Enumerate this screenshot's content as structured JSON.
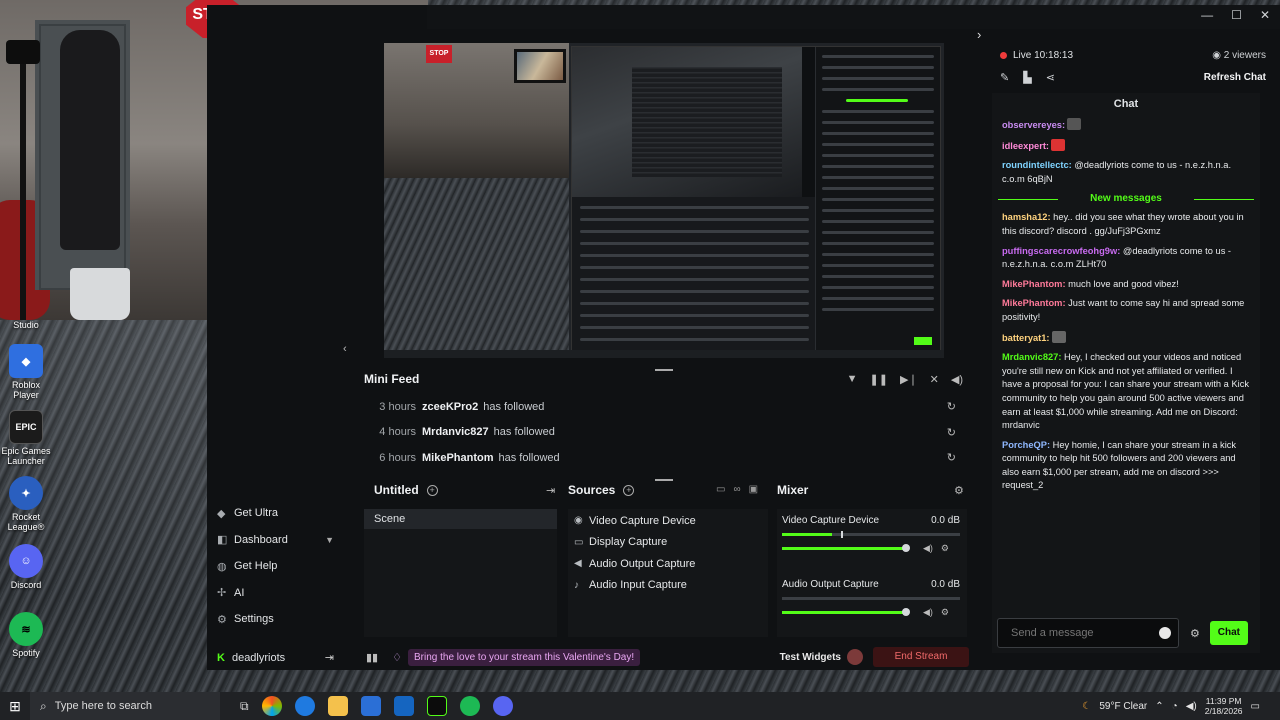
{
  "desktop": {
    "icons": [
      {
        "label": "Studio",
        "icon": "studio-icon",
        "color": "#1a1a1a"
      },
      {
        "label": "Roblox Player",
        "icon": "roblox-icon",
        "color": "#2f6fe0"
      },
      {
        "label": "Epic Games Launcher",
        "icon": "epic-games-icon",
        "color": "#1b1b1b"
      },
      {
        "label": "Rocket League®",
        "icon": "rocket-league-icon",
        "color": "#2a5fbf"
      },
      {
        "label": "Discord",
        "icon": "discord-icon",
        "color": "#5865f2"
      },
      {
        "label": "Spotify",
        "icon": "spotify-icon",
        "color": "#1db954"
      }
    ],
    "webcam_sign": "STOP",
    "epic_glyph": "EPIC"
  },
  "window": {
    "controls": [
      "—",
      "☐",
      "✕"
    ]
  },
  "nav": {
    "items": [
      {
        "label": "Get Ultra",
        "icon": "ultra-icon"
      },
      {
        "label": "Dashboard",
        "icon": "dashboard-icon"
      },
      {
        "label": "Get Help",
        "icon": "help-icon"
      },
      {
        "label": "AI",
        "icon": "ai-icon"
      },
      {
        "label": "Settings",
        "icon": "gear-icon"
      }
    ],
    "user": "deadlyriots"
  },
  "minifeed": {
    "title": "Mini Feed",
    "rows": [
      {
        "time": "3 hours",
        "user": "zceeKPro2",
        "action": "has followed"
      },
      {
        "time": "4 hours",
        "user": "Mrdanvic827",
        "action": "has followed"
      },
      {
        "time": "6 hours",
        "user": "MikePhantom",
        "action": "has followed"
      }
    ]
  },
  "scenes": {
    "title": "Untitled",
    "items": [
      "Scene"
    ]
  },
  "sources": {
    "title": "Sources",
    "items": [
      {
        "label": "Video Capture Device",
        "icon": "camera-icon"
      },
      {
        "label": "Display Capture",
        "icon": "monitor-icon"
      },
      {
        "label": "Audio Output Capture",
        "icon": "speaker-icon"
      },
      {
        "label": "Audio Input Capture",
        "icon": "microphone-icon"
      }
    ]
  },
  "mixer": {
    "title": "Mixer",
    "channels": [
      {
        "name": "Video Capture Device",
        "db": "0.0 dB",
        "level": 0.28,
        "peak": 0.33,
        "volume": 1.0
      },
      {
        "name": "Audio Output Capture",
        "db": "0.0 dB",
        "level": 0.0,
        "peak": 0.0,
        "volume": 1.0
      }
    ]
  },
  "bottombar": {
    "promo": "Bring the love to your stream this Valentine's Day!",
    "test_widgets": "Test Widgets",
    "end_stream": "End Stream"
  },
  "stream": {
    "live": "Live 10:18:13",
    "viewers": "2 viewers",
    "refresh": "Refresh Chat"
  },
  "chat": {
    "title": "Chat",
    "new_messages": "New messages",
    "before": [
      {
        "name": "observereyes:",
        "color": "#c88cf0",
        "text": ""
      },
      {
        "name": "idleexpert:",
        "color": "#ff8ad8",
        "text": ""
      },
      {
        "name": "roundintellectc:",
        "color": "#7fd3ff",
        "text": "@deadlyriots come to us - n.e.z.h.n.a. c.o.m 6qBjN"
      }
    ],
    "after": [
      {
        "name": "hamsha12:",
        "color": "#ffd37f",
        "text": "hey.. did you see what they wrote about you in this discord? discord . gg/JuFj3PGxmz"
      },
      {
        "name": "puffingscarecrowfeohg9w:",
        "color": "#c86bf0",
        "text": "@deadlyriots come to us - n.e.z.h.n.a. c.o.m ZLHt70"
      },
      {
        "name": "MikePhantom:",
        "color": "#ff7a9a",
        "text": "much love and good vibez!"
      },
      {
        "name": "MikePhantom:",
        "color": "#ff7a9a",
        "text": "Just want to come say hi and spread some positivity!"
      },
      {
        "name": "batteryat1:",
        "color": "#ffd37f",
        "text": ""
      },
      {
        "name": "Mrdanvic827:",
        "color": "#53fc18",
        "text": "Hey, I checked out your videos and noticed you're still new on Kick and not yet affiliated or verified. I have a proposal for you: I can share your stream with a Kick community to help you gain around 500 active viewers and earn at least $1,000 while streaming. Add me on Discord: mrdanvic"
      },
      {
        "name": "PorcheQP:",
        "color": "#8fb8ff",
        "text": "Hey homie, I can share your stream in a kick community to help hit 500 followers and 200 viewers and also earn $1,000 per stream, add me on discord >>> request_2"
      }
    ],
    "input_placeholder": "Send a message",
    "send": "Chat"
  },
  "taskbar": {
    "search_placeholder": "Type here to search",
    "weather": "59°F  Clear",
    "time": "11:39 PM",
    "date": "2/18/2026"
  },
  "colors": {
    "accent": "#53fc18",
    "live": "#ef3b3b",
    "end_stream": "#f06a6a"
  }
}
